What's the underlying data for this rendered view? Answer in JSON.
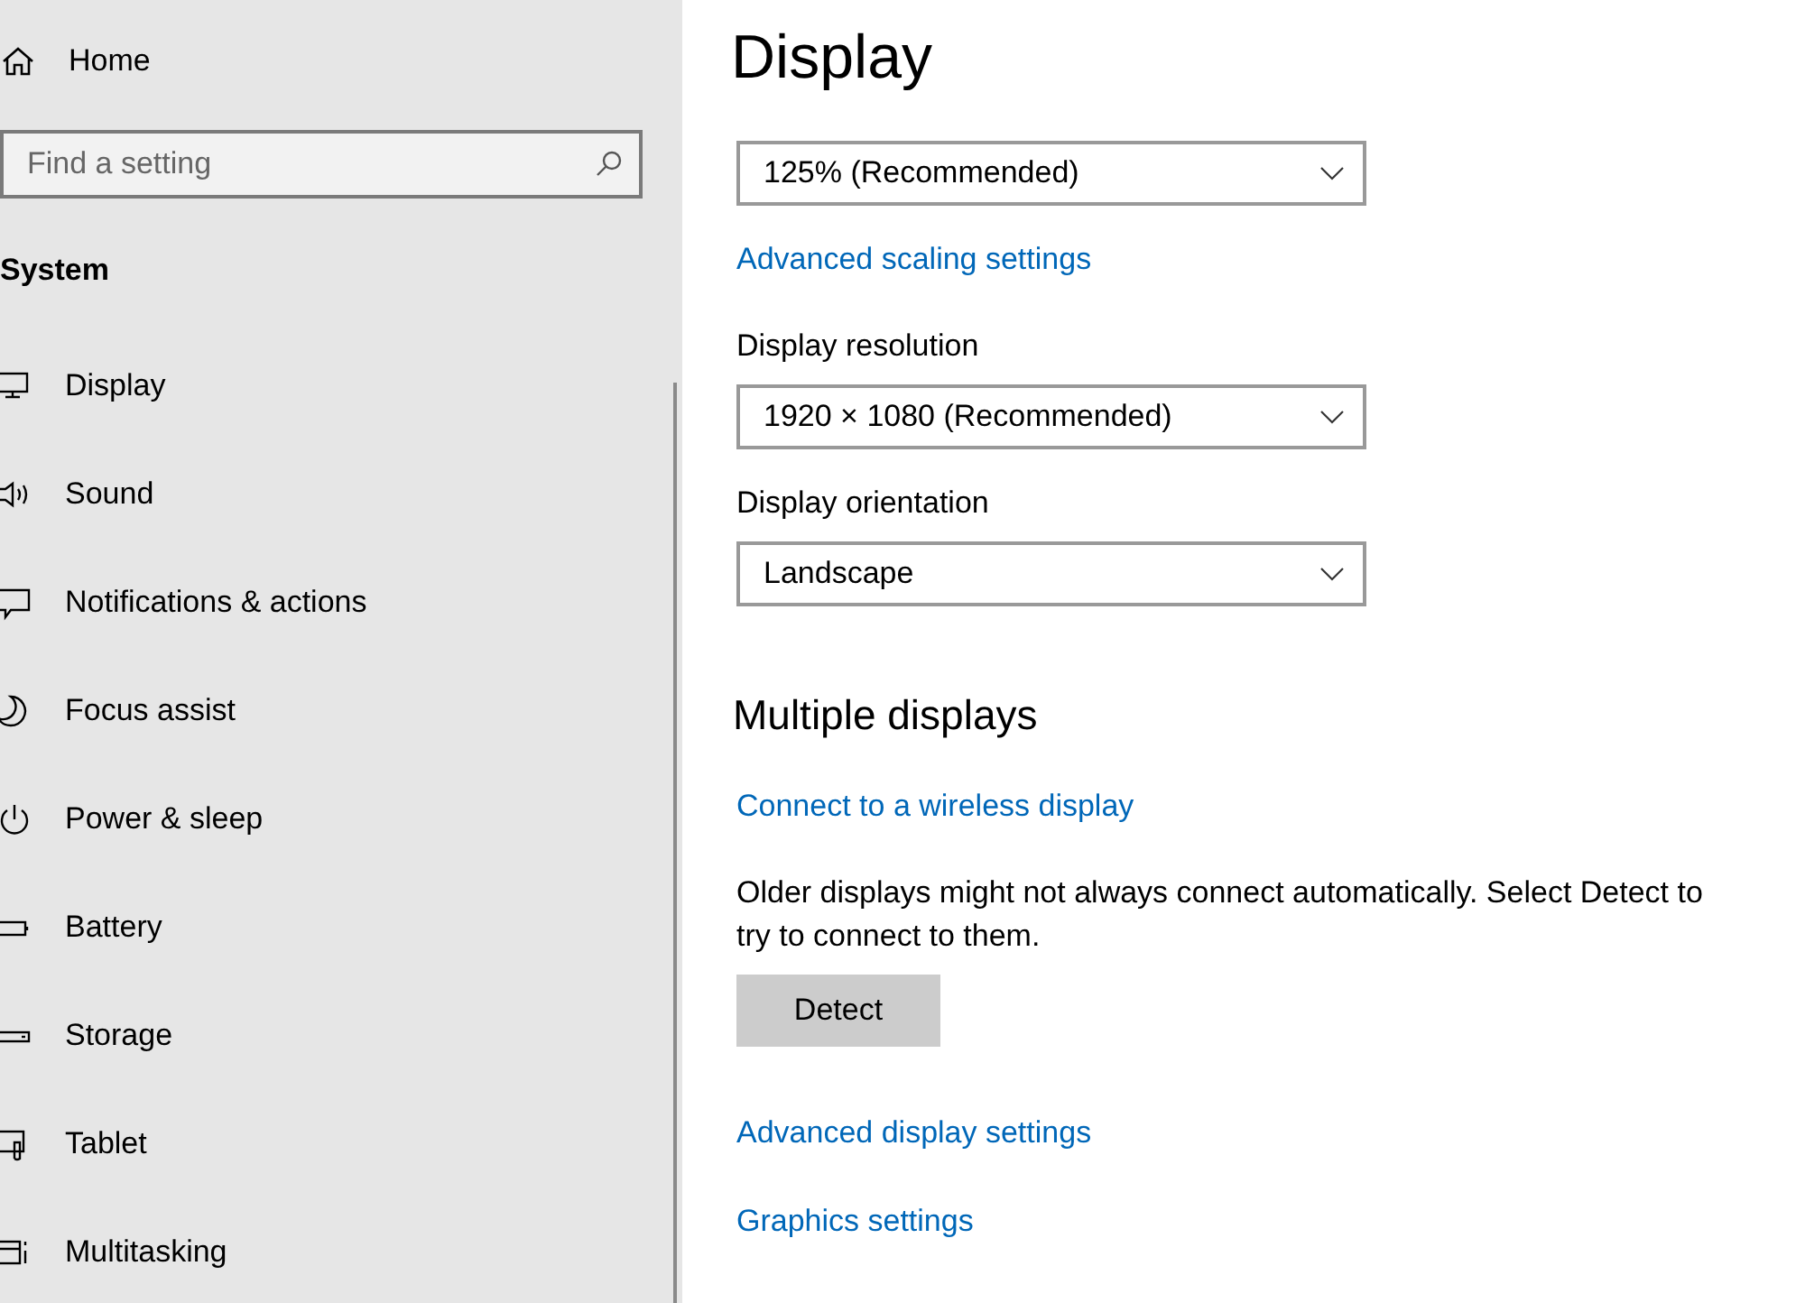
{
  "sidebar": {
    "home": "Home",
    "search": {
      "placeholder": "Find a setting"
    },
    "section": "System",
    "items": [
      {
        "label": "Display",
        "selected": false
      },
      {
        "label": "Sound",
        "selected": false
      },
      {
        "label": "Notifications & actions",
        "selected": false
      },
      {
        "label": "Focus assist",
        "selected": false
      },
      {
        "label": "Power & sleep",
        "selected": false
      },
      {
        "label": "Battery",
        "selected": false
      },
      {
        "label": "Storage",
        "selected": false
      },
      {
        "label": "Tablet",
        "selected": false
      },
      {
        "label": "Multitasking",
        "selected": false
      }
    ]
  },
  "page": {
    "title": "Display",
    "scale": {
      "value": "125% (Recommended)"
    },
    "scaling_link": "Advanced scaling settings",
    "resolution": {
      "label": "Display resolution",
      "value": "1920 × 1080 (Recommended)"
    },
    "orientation": {
      "label": "Display orientation",
      "value": "Landscape"
    },
    "multiple": {
      "heading": "Multiple displays",
      "wireless_link": "Connect to a wireless display",
      "note": "Older displays might not always connect automatically. Select Detect to try to connect to them.",
      "detect_button": "Detect"
    },
    "links": [
      "Advanced display settings",
      "Graphics settings"
    ]
  }
}
